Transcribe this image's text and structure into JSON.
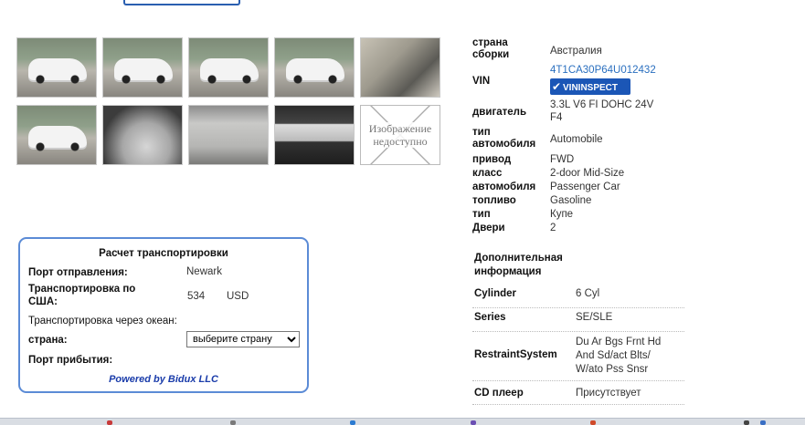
{
  "gallery": [
    {
      "kind": "car",
      "alt": "photo-1"
    },
    {
      "kind": "car",
      "alt": "photo-2"
    },
    {
      "kind": "car",
      "alt": "photo-3"
    },
    {
      "kind": "car",
      "alt": "photo-4"
    },
    {
      "kind": "interior",
      "alt": "photo-5"
    },
    {
      "kind": "car",
      "alt": "photo-6"
    },
    {
      "kind": "gauge",
      "alt": "photo-7"
    },
    {
      "kind": "seats",
      "alt": "photo-8"
    },
    {
      "kind": "label",
      "alt": "photo-9"
    },
    {
      "kind": "unavail",
      "alt": "photo-10"
    }
  ],
  "unavailable_text_1": "Изображение",
  "unavailable_text_2": "недоступно",
  "specs": {
    "country_label_1": "страна",
    "country_label_2": "сборки",
    "country_value": "Австралия",
    "vin_label": "VIN",
    "vin_value": "4T1CA30P64U012432",
    "vininspect_badge": "VININSPECT",
    "engine_label": "двигатель",
    "engine_value_1": "3.3L V6 FI DOHC 24V",
    "engine_value_2": "F4",
    "type_label_1": "тип",
    "type_label_2": "автомобиля",
    "type_value": "Automobile",
    "drive_label": "привод",
    "drive_value": "FWD",
    "class_label": "класс",
    "class_value": "2-door Mid-Size",
    "auto_label": "автомобиля",
    "auto_value": "Passenger Car",
    "fuel_label": "топливо",
    "fuel_value": "Gasoline",
    "body_label": "тип",
    "body_value": "Купе",
    "doors_label": "Двери",
    "doors_value": "2"
  },
  "extra": {
    "heading_1": "Дополнительная",
    "heading_2": "информация",
    "rows": [
      {
        "key": "Cylinder",
        "value": "6 Cyl"
      },
      {
        "key": "Series",
        "value": "SE/SLE"
      },
      {
        "key": "RestraintSystem",
        "value_1": "Du Ar Bgs Frnt Hd",
        "value_2": "And Sd/act Blts/",
        "value_3": "W/ato Pss Snsr"
      },
      {
        "key": "CD плеер",
        "value": "Присутствует"
      }
    ]
  },
  "shipping": {
    "title": "Расчет транспортировки",
    "departure_label": "Порт отправления:",
    "departure_value": "Newark",
    "usa_label_1": "Транспортировка по",
    "usa_label_2": "США:",
    "usa_value": "534",
    "usa_currency": "USD",
    "ocean_label": "Транспортировка через океан:",
    "country_label": "страна:",
    "country_select": "выберите страну",
    "arrival_label": "Порт прибытия:",
    "powered": "Powered by Bidux LLC"
  }
}
